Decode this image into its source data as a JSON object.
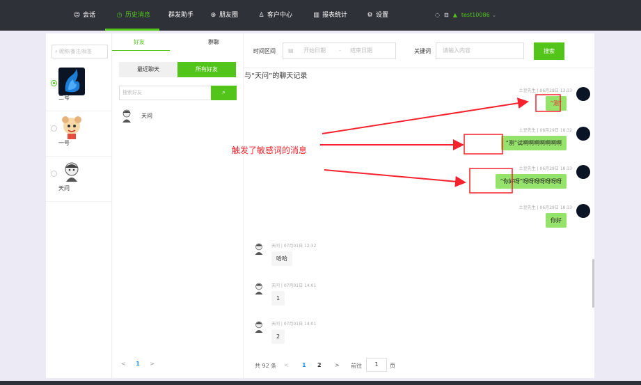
{
  "nav": {
    "items": [
      {
        "icon": "chat-bubble-icon",
        "label": "会话"
      },
      {
        "icon": "clock-icon",
        "label": "历史消息"
      },
      {
        "icon": "",
        "label": "群发助手"
      },
      {
        "icon": "aperture-icon",
        "label": "朋友圈"
      },
      {
        "icon": "user-icon",
        "label": "客户中心"
      },
      {
        "icon": "bar-chart-icon",
        "label": "报表统计"
      },
      {
        "icon": "gear-icon",
        "label": "设置"
      }
    ],
    "active_index": 1,
    "username": "test10086",
    "accent_color": "#52c41a",
    "bar_color": "#2e3238"
  },
  "contacts": {
    "search_placeholder": "昵称/备注/标签",
    "items": [
      {
        "name": "二号",
        "selected": true
      },
      {
        "name": "一号",
        "selected": false
      },
      {
        "name": "天问",
        "selected": false
      }
    ]
  },
  "friends": {
    "tabs": [
      "好友",
      "群聊"
    ],
    "segments": [
      "最近聊天",
      "所有好友"
    ],
    "search_placeholder": "搜索好友",
    "items": [
      {
        "name": "天问"
      }
    ],
    "pager": {
      "prev": "<",
      "current": "1",
      "next": ">"
    }
  },
  "chat": {
    "filter": {
      "time_label": "时间区间",
      "start_placeholder": "开始日期",
      "separator": "-",
      "end_placeholder": "结束日期",
      "keyword_label": "关键词",
      "keyword_placeholder": "请输入内容",
      "search_button": "搜索"
    },
    "title": "与“天问”的聊天记录",
    "messages": [
      {
        "side": "mine",
        "meta": "土豆先生 | 06月28日 13:33",
        "text": "“测”"
      },
      {
        "side": "mine",
        "meta": "土豆先生 | 06月29日 18:32",
        "text": "“测”试啊啊啊啊啊啊啊"
      },
      {
        "side": "mine",
        "meta": "土豆先生 | 06月29日 18:33",
        "text": "“你好呀”呀呀呀呀呀呀呀"
      },
      {
        "side": "mine",
        "meta": "土豆先生 | 06月29日 18:33",
        "text": "你好"
      },
      {
        "side": "theirs",
        "meta": "天问 | 07月01日 12:32",
        "text": "哈哈"
      },
      {
        "side": "theirs",
        "meta": "天问 | 07月01日 14:01",
        "text": "1"
      },
      {
        "side": "theirs",
        "meta": "天问 | 07月01日 14:01",
        "text": "2"
      }
    ],
    "pager": {
      "total": "共 92 条",
      "prev": "<",
      "page1": "1",
      "page2": "2",
      "next": ">",
      "goto": "前往",
      "goto_value": "1",
      "page_unit": "页"
    }
  },
  "annotation": {
    "text": "触发了敏感词的消息",
    "color": "#f5222d"
  }
}
